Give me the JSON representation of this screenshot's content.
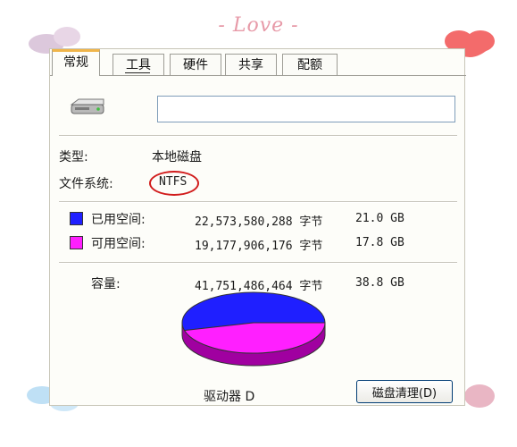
{
  "header": {
    "decoration_text": "- Love -"
  },
  "tabs": [
    {
      "label": "常规"
    },
    {
      "label": "工具"
    },
    {
      "label": "硬件"
    },
    {
      "label": "共享"
    },
    {
      "label": "配额"
    }
  ],
  "general": {
    "name_value": "",
    "type_label": "类型:",
    "type_value": "本地磁盘",
    "fs_label": "文件系统:",
    "fs_value": "NTFS",
    "used_label": "已用空间:",
    "used_bytes": "22,573,580,288 字节",
    "used_gb": "21.0 GB",
    "free_label": "可用空间:",
    "free_bytes": "19,177,906,176 字节",
    "free_gb": "17.8 GB",
    "capacity_label": "容量:",
    "capacity_bytes": "41,751,486,464 字节",
    "capacity_gb": "38.8 GB",
    "drive_label": "驱动器 D",
    "cleanup_label": "磁盘清理(D)"
  },
  "usage": {
    "used_fraction": 0.5407,
    "free_fraction": 0.4593
  },
  "colors": {
    "used": "#1f1fff",
    "free": "#ff1fff",
    "used_side": "#0000a8",
    "free_side": "#a000a0",
    "ring": "#d11c1c",
    "tab_accent": "#f0b54a"
  },
  "icons": {
    "drive": "hard-drive-icon"
  }
}
